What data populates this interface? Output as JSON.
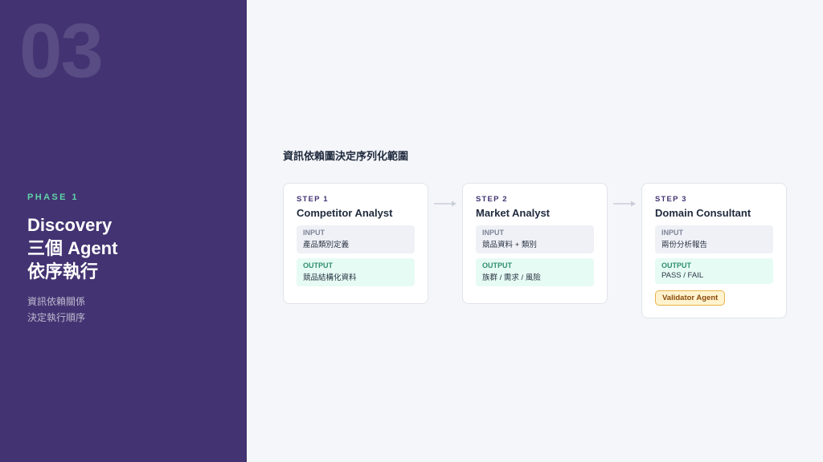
{
  "phase_panel": {
    "number": "03",
    "phase_label": "PHASE 1",
    "title_lines": [
      "Discovery",
      "三個 Agent",
      "依序執行"
    ],
    "subtitle_lines": [
      "資訊依賴關係",
      "決定執行順序"
    ]
  },
  "flow": {
    "title": "資訊依賴圖決定序列化範圍",
    "steps": [
      {
        "step_label": "STEP 1",
        "name": "Competitor Analyst",
        "input_label": "INPUT",
        "input_value": "產品類別定義",
        "output_label": "OUTPUT",
        "output_value": "競品結構化資料"
      },
      {
        "step_label": "STEP 2",
        "name": "Market Analyst",
        "input_label": "INPUT",
        "input_value": "競品資料 + 類別",
        "output_label": "OUTPUT",
        "output_value": "族群 / 需求 / 風險"
      },
      {
        "step_label": "STEP 3",
        "name": "Domain Consultant",
        "input_label": "INPUT",
        "input_value": "兩份分析報告",
        "output_label": "OUTPUT",
        "output_value": "PASS / FAIL",
        "badge": "Validator Agent"
      }
    ]
  },
  "colors": {
    "panel_bg": "#433372",
    "accent_green": "#5fd3a6",
    "badge_border": "#e8b34a"
  },
  "icons": {
    "connector": "arrow-right-icon"
  }
}
